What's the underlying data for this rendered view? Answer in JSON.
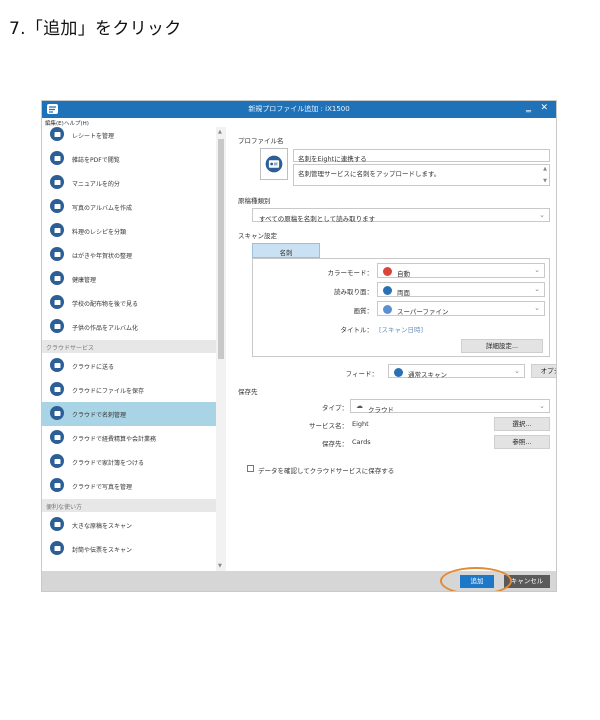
{
  "caption": "7.「追加」をクリック",
  "window": {
    "title": "新規プロファイル追加 : iX1500",
    "min_icon": "minimize-icon",
    "close_icon": "close-icon",
    "accent": "#1f72b8"
  },
  "menu": [
    "編集(E)",
    "ヘルプ(H)"
  ],
  "sidebar": {
    "items_top": [
      {
        "label": "レシートを管理",
        "icon": "receipt-icon"
      },
      {
        "label": "雑誌をPDFで閲覧",
        "icon": "magazine-icon"
      },
      {
        "label": "マニュアルを的分",
        "icon": "manual-icon"
      },
      {
        "label": "写真のアルバムを作成",
        "icon": "photo-album-icon"
      },
      {
        "label": "料理のレシピを分類",
        "icon": "recipe-icon"
      },
      {
        "label": "はがきや年賀状の整理",
        "icon": "postcard-icon"
      },
      {
        "label": "健康管理",
        "icon": "health-icon"
      },
      {
        "label": "学校の配布物を後で見る",
        "icon": "school-handout-icon"
      },
      {
        "label": "子供の作品をアルバム化",
        "icon": "kids-art-icon"
      }
    ],
    "section_cloud": "クラウドサービス",
    "items_cloud": [
      {
        "label": "クラウドに送る",
        "icon": "cloud-send-icon"
      },
      {
        "label": "クラウドにファイルを保存",
        "icon": "cloud-save-icon"
      },
      {
        "label": "クラウドで名刺管理",
        "icon": "cloud-card-icon",
        "selected": true
      },
      {
        "label": "クラウドで経費精算や会計業務",
        "icon": "cloud-expense-icon"
      },
      {
        "label": "クラウドで家計簿をつける",
        "icon": "cloud-household-icon"
      },
      {
        "label": "クラウドで写真を管理",
        "icon": "cloud-photo-icon"
      }
    ],
    "section_handy": "便利な使い方",
    "items_handy": [
      {
        "label": "大きな原稿をスキャン",
        "icon": "large-doc-icon"
      },
      {
        "label": "封筒や伝票をスキャン",
        "icon": "envelope-icon"
      }
    ]
  },
  "profile": {
    "section_label": "プロファイル名",
    "name_value": "名刺をEightに連携する",
    "description_value": "名刺管理サービスに名刺をアップロードします。"
  },
  "doc_type": {
    "label": "原稿種類別",
    "value": "すべての原稿を名刺として読み取ります"
  },
  "scan_settings": {
    "label": "スキャン設定",
    "tab": "名刺",
    "rows": [
      {
        "label": "カラーモード：",
        "value": "自動",
        "icon": "auto-color-icon"
      },
      {
        "label": "読み取り面：",
        "value": "両面",
        "icon": "duplex-icon"
      },
      {
        "label": "画質：",
        "value": "スーパーファイン",
        "icon": "quality-icon"
      }
    ],
    "title_label": "タイトル：",
    "title_value": "[スキャン日時]",
    "detail_button": "詳細設定..."
  },
  "feed": {
    "label": "フィード：",
    "value": "通常スキャン",
    "options_button": "オプション..."
  },
  "save_to": {
    "label": "保存先",
    "type_label": "タイプ：",
    "type_value": "クラウド",
    "service_label": "サービス名：",
    "service_value": "Eight",
    "select_button": "選択...",
    "dest_label": "保存先：",
    "dest_value": "Cards",
    "browse_button": "参照..."
  },
  "checkbox_label": "データを確認してクラウドサービスに保存する",
  "footer": {
    "add_button": "追加",
    "cancel_button": "キャンセル",
    "highlight_color": "#e28a35"
  }
}
